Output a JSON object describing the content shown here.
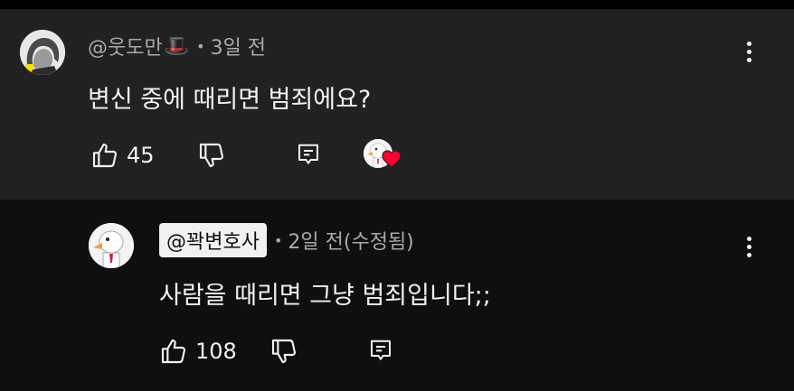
{
  "comment": {
    "username": "@웃도만",
    "badge_emoji": "🎩",
    "time": "3일 전",
    "text": "변신 중에 때리면 범죄에요?",
    "like_count": "45",
    "icons": [
      "thumb-up-icon",
      "thumb-down-icon",
      "reply-icon",
      "creator-heart-icon",
      "more-vert-icon"
    ]
  },
  "reply": {
    "username": "@꽉변호사",
    "time": "2일 전(수정됨)",
    "text": "사람을 때리면 그냥 범죄입니다;;",
    "like_count": "108",
    "icons": [
      "thumb-up-icon",
      "thumb-down-icon",
      "reply-icon",
      "more-vert-icon"
    ]
  },
  "colors": {
    "comment_bg": "#212121",
    "reply_bg": "#0f0f0f",
    "text": "#f1f1f1",
    "meta": "#aaaaaa",
    "heart": "#ff0033"
  }
}
